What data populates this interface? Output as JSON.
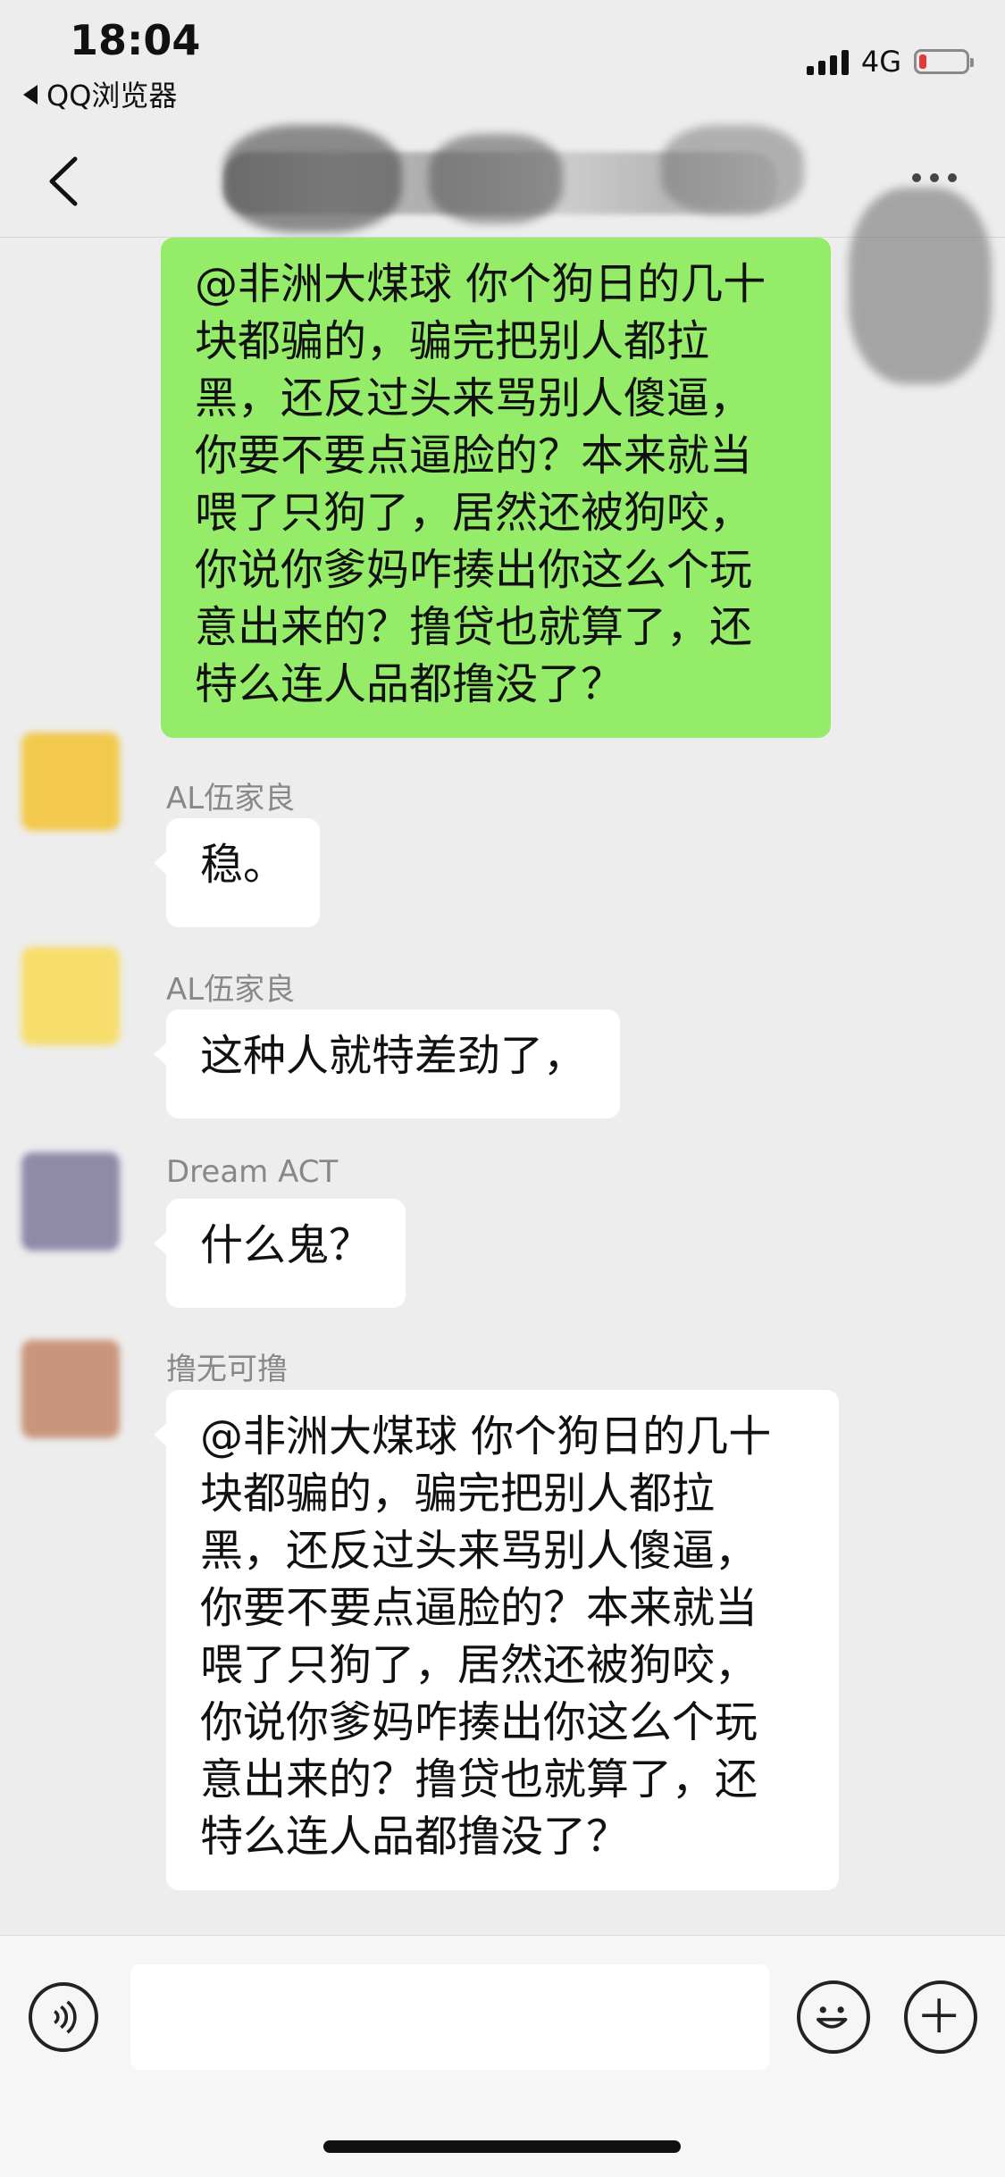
{
  "status_bar": {
    "time": "18:04",
    "back_app": "QQ浏览器",
    "network": "4G",
    "battery_level": 0.15
  },
  "nav": {
    "title": "",
    "more_icon": "more-dots-icon",
    "back_icon": "chevron-left-icon"
  },
  "messages": [
    {
      "side": "right",
      "color": "#95ec69",
      "text": "@非洲大煤球 你个狗日的几十\n块都骗的，骗完把别人都拉\n黑，还反过头来骂别人傻逼，\n你要不要点逼脸的？本来就当\n喂了只狗了，居然还被狗咬，\n你说你爹妈咋揍出你这么个玩\n意出来的？撸贷也就算了，还\n特么连人品都撸没了？"
    },
    {
      "side": "left",
      "sender": "AL伍家良",
      "text": "稳。"
    },
    {
      "side": "left",
      "sender": "AL伍家良",
      "text": "这种人就特差劲了，"
    },
    {
      "side": "left",
      "sender": "Dream ACT",
      "text": "什么鬼？"
    },
    {
      "side": "left",
      "sender": "撸无可撸",
      "text": "@非洲大煤球 你个狗日的几十\n块都骗的，骗完把别人都拉\n黑，还反过头来骂别人傻逼，\n你要不要点逼脸的？本来就当\n喂了只狗了，居然还被狗咬，\n你说你爹妈咋揍出你这么个玩\n意出来的？撸贷也就算了，还\n特么连人品都撸没了？"
    }
  ],
  "input_bar": {
    "voice_icon": "voice-icon",
    "emoji_icon": "emoji-icon",
    "plus_icon": "plus-icon",
    "placeholder": ""
  }
}
